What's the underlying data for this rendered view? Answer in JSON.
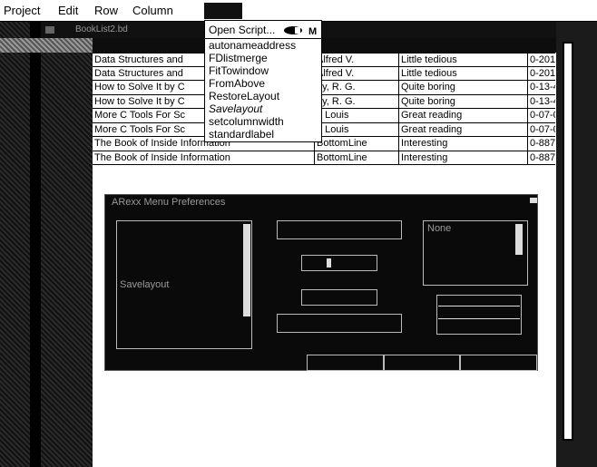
{
  "menubar": {
    "items": [
      "Project",
      "Edit",
      "Row",
      "Column"
    ]
  },
  "window": {
    "title": "BookList2.bd"
  },
  "table": {
    "rows": [
      [
        "Data Structures and",
        "Alfred V.",
        "Little tedious",
        "0-201-"
      ],
      [
        "Data Structures and",
        "Alfred V.",
        "Little tedious",
        "0-201-"
      ],
      [
        "How to Solve It by C",
        "ey, R. G.",
        "Quite boring",
        "0-13-4"
      ],
      [
        "How to Solve It by C",
        "ey, R. G.",
        "Quite boring",
        "0-13-4"
      ],
      [
        "More C Tools For Sc",
        "r, Louis",
        "Great reading",
        "0-07-0"
      ],
      [
        "More C Tools For Sc",
        "r, Louis",
        "Great reading",
        "0-07-0"
      ],
      [
        "The Book of Inside Information",
        "BottomLine",
        "Interesting",
        "0-887"
      ],
      [
        "The Book of Inside Information",
        "BottomLine",
        "Interesting",
        "0-887"
      ]
    ]
  },
  "menu": {
    "open_script": "Open Script...",
    "shortcut": "M",
    "items": [
      "autonameaddress",
      "FDlistmerge",
      "FitTowindow",
      "FromAbove",
      "RestoreLayout",
      "Savelayout",
      "setcolumnwidth",
      "standardlabel"
    ]
  },
  "dialog": {
    "title": "ARexx Menu Preferences",
    "list_item": "Savelayout",
    "key_value": "None"
  }
}
